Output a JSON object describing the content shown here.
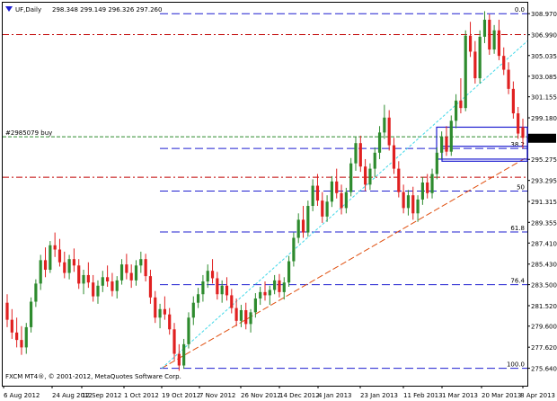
{
  "window": {
    "title_icon": "down-arrow-icon",
    "symbol_text": "UF,Daily",
    "ohlc_text": "298.348 299.149 296.326 297.260"
  },
  "footer": {
    "watermark": "FXCM MT4®, © 2001-2012, MetaQuotes Software Corp."
  },
  "colors": {
    "bull": "#2e8b2e",
    "bear": "#e02020",
    "fib_line": "#1f1fd0",
    "red_level": "#c00000",
    "order_line": "#2e8b2e",
    "trend_up": "#e05010",
    "channel": "#40d8e8",
    "box": "#1f1fd0",
    "price_tag_bg": "#000000"
  },
  "chart_data": {
    "type": "candlestick",
    "symbol": "UF",
    "timeframe": "Daily",
    "ylim": [
      274.0,
      310.0
    ],
    "y_ticks": [
      "308.970",
      "306.990",
      "305.035",
      "303.085",
      "301.155",
      "299.180",
      "297.260",
      "295.275",
      "293.295",
      "291.315",
      "289.355",
      "287.410",
      "285.430",
      "283.500",
      "281.520",
      "279.600",
      "277.620",
      "275.640"
    ],
    "x_tick_labels": [
      "6 Aug 2012",
      "24 Aug 2012",
      "12 Sep 2012",
      "1 Oct 2012",
      "19 Oct 2012",
      "7 Nov 2012",
      "26 Nov 2012",
      "14 Dec 2012",
      "4 Jan 2013",
      "23 Jan 2013",
      "11 Feb 2013",
      "1 Mar 2013",
      "20 Mar 2013",
      "8 Apr 2013"
    ],
    "last_price": "297.260",
    "order_label": "#2985079 buy",
    "order_price": 297.4,
    "fib_levels": [
      {
        "label": "0.0",
        "price": 308.97
      },
      {
        "label": "38.2",
        "price": 296.3
      },
      {
        "label": "50",
        "price": 292.3
      },
      {
        "label": "61.8",
        "price": 288.45
      },
      {
        "label": "76.4",
        "price": 283.5
      },
      {
        "label": "100.0",
        "price": 275.64
      }
    ],
    "red_levels": [
      307.0,
      293.6
    ],
    "candles": [
      [
        281.8,
        282.6,
        279.5,
        280.2
      ],
      [
        280.2,
        281.2,
        278.4,
        279.0
      ],
      [
        279.0,
        280.4,
        277.6,
        278.3
      ],
      [
        278.3,
        279.6,
        276.9,
        277.6
      ],
      [
        277.6,
        279.9,
        277.0,
        279.5
      ],
      [
        279.5,
        282.3,
        279.0,
        281.9
      ],
      [
        281.9,
        284.0,
        281.4,
        283.6
      ],
      [
        283.6,
        286.3,
        283.0,
        285.8
      ],
      [
        285.8,
        287.0,
        284.2,
        284.9
      ],
      [
        284.9,
        287.6,
        284.6,
        287.2
      ],
      [
        287.2,
        288.4,
        286.1,
        286.8
      ],
      [
        286.8,
        287.8,
        285.2,
        285.6
      ],
      [
        285.6,
        286.6,
        284.1,
        284.6
      ],
      [
        284.6,
        286.3,
        284.0,
        285.9
      ],
      [
        285.9,
        286.9,
        284.7,
        285.3
      ],
      [
        285.3,
        285.9,
        283.1,
        283.6
      ],
      [
        283.6,
        284.9,
        282.6,
        284.4
      ],
      [
        284.4,
        285.6,
        283.2,
        283.7
      ],
      [
        283.7,
        284.4,
        281.9,
        282.4
      ],
      [
        282.4,
        283.9,
        281.7,
        283.4
      ],
      [
        283.4,
        284.8,
        282.8,
        284.2
      ],
      [
        284.2,
        285.3,
        283.3,
        283.8
      ],
      [
        283.8,
        284.6,
        282.4,
        282.9
      ],
      [
        282.9,
        284.3,
        282.2,
        283.9
      ],
      [
        283.9,
        285.9,
        283.5,
        285.4
      ],
      [
        285.4,
        286.4,
        284.0,
        284.6
      ],
      [
        284.6,
        285.4,
        283.2,
        283.9
      ],
      [
        283.9,
        285.8,
        283.4,
        285.3
      ],
      [
        285.3,
        286.6,
        284.6,
        285.9
      ],
      [
        285.9,
        286.4,
        283.8,
        284.3
      ],
      [
        284.3,
        284.9,
        281.7,
        282.3
      ],
      [
        282.3,
        282.9,
        279.9,
        280.4
      ],
      [
        280.4,
        281.7,
        279.4,
        281.2
      ],
      [
        281.2,
        282.4,
        280.2,
        280.7
      ],
      [
        280.7,
        281.3,
        278.8,
        279.3
      ],
      [
        279.3,
        279.9,
        276.4,
        277.0
      ],
      [
        277.0,
        277.9,
        275.4,
        275.9
      ],
      [
        275.9,
        278.4,
        275.6,
        277.9
      ],
      [
        277.9,
        280.9,
        277.5,
        280.4
      ],
      [
        280.4,
        282.4,
        279.7,
        281.8
      ],
      [
        281.8,
        283.2,
        281.3,
        282.6
      ],
      [
        282.6,
        284.4,
        281.9,
        283.8
      ],
      [
        283.8,
        285.4,
        283.2,
        284.8
      ],
      [
        284.8,
        285.9,
        283.6,
        284.1
      ],
      [
        284.1,
        284.7,
        282.1,
        282.6
      ],
      [
        282.6,
        283.9,
        281.8,
        283.4
      ],
      [
        283.4,
        284.2,
        282.0,
        282.5
      ],
      [
        282.5,
        283.1,
        280.8,
        281.3
      ],
      [
        281.3,
        282.2,
        279.6,
        280.1
      ],
      [
        280.1,
        281.6,
        279.5,
        281.1
      ],
      [
        281.1,
        281.8,
        279.3,
        279.8
      ],
      [
        279.8,
        281.2,
        279.0,
        280.9
      ],
      [
        280.9,
        282.7,
        280.4,
        282.2
      ],
      [
        282.2,
        283.3,
        281.6,
        282.8
      ],
      [
        282.8,
        283.8,
        282.0,
        282.5
      ],
      [
        282.5,
        283.4,
        281.6,
        283.0
      ],
      [
        283.0,
        284.4,
        282.6,
        283.9
      ],
      [
        283.9,
        284.5,
        282.3,
        282.8
      ],
      [
        282.8,
        284.2,
        282.1,
        283.7
      ],
      [
        283.7,
        286.2,
        283.3,
        285.7
      ],
      [
        285.7,
        288.4,
        285.2,
        287.9
      ],
      [
        287.9,
        290.2,
        287.4,
        289.6
      ],
      [
        289.6,
        290.9,
        287.9,
        288.4
      ],
      [
        288.4,
        291.4,
        288.0,
        290.9
      ],
      [
        290.9,
        293.4,
        290.4,
        292.8
      ],
      [
        292.8,
        293.9,
        290.9,
        291.4
      ],
      [
        291.4,
        292.2,
        289.3,
        289.9
      ],
      [
        289.9,
        291.9,
        289.4,
        291.3
      ],
      [
        291.3,
        293.7,
        290.8,
        293.2
      ],
      [
        293.2,
        294.4,
        291.6,
        292.1
      ],
      [
        292.1,
        292.9,
        290.1,
        290.7
      ],
      [
        290.7,
        292.6,
        290.2,
        292.2
      ],
      [
        292.2,
        295.4,
        291.8,
        294.9
      ],
      [
        294.9,
        297.4,
        294.2,
        296.8
      ],
      [
        296.8,
        297.5,
        294.1,
        294.6
      ],
      [
        294.6,
        295.3,
        292.3,
        292.9
      ],
      [
        292.9,
        294.9,
        292.4,
        294.4
      ],
      [
        294.4,
        296.4,
        293.6,
        295.9
      ],
      [
        295.9,
        298.4,
        295.3,
        297.8
      ],
      [
        297.8,
        300.4,
        297.2,
        299.2
      ],
      [
        299.2,
        299.9,
        296.1,
        296.6
      ],
      [
        296.6,
        297.3,
        293.9,
        294.4
      ],
      [
        294.4,
        295.1,
        291.7,
        292.2
      ],
      [
        292.2,
        292.9,
        290.2,
        290.7
      ],
      [
        290.7,
        292.4,
        290.0,
        291.9
      ],
      [
        291.9,
        292.7,
        289.6,
        290.2
      ],
      [
        290.2,
        291.9,
        289.4,
        291.5
      ],
      [
        291.5,
        293.6,
        291.0,
        293.1
      ],
      [
        293.1,
        293.9,
        291.6,
        292.1
      ],
      [
        292.1,
        294.4,
        291.6,
        293.9
      ],
      [
        293.9,
        296.4,
        293.4,
        295.9
      ],
      [
        295.9,
        297.9,
        295.3,
        297.4
      ],
      [
        297.4,
        298.4,
        295.6,
        296.0
      ],
      [
        296.0,
        299.4,
        295.6,
        298.9
      ],
      [
        298.9,
        301.4,
        298.2,
        300.8
      ],
      [
        300.8,
        302.9,
        299.6,
        300.1
      ],
      [
        300.1,
        307.4,
        299.8,
        306.9
      ],
      [
        306.9,
        308.2,
        304.9,
        305.4
      ],
      [
        305.4,
        306.4,
        302.4,
        302.9
      ],
      [
        302.9,
        307.4,
        302.4,
        306.8
      ],
      [
        306.8,
        309.2,
        306.2,
        308.4
      ],
      [
        308.4,
        308.9,
        305.1,
        305.6
      ],
      [
        305.6,
        307.9,
        305.2,
        307.4
      ],
      [
        307.4,
        308.4,
        304.6,
        305.0
      ],
      [
        305.0,
        305.8,
        303.2,
        303.7
      ],
      [
        303.7,
        304.4,
        301.4,
        301.9
      ],
      [
        301.9,
        302.6,
        299.1,
        299.6
      ],
      [
        299.6,
        300.2,
        297.2,
        297.7
      ],
      [
        298.3,
        299.1,
        296.3,
        297.3
      ]
    ]
  }
}
